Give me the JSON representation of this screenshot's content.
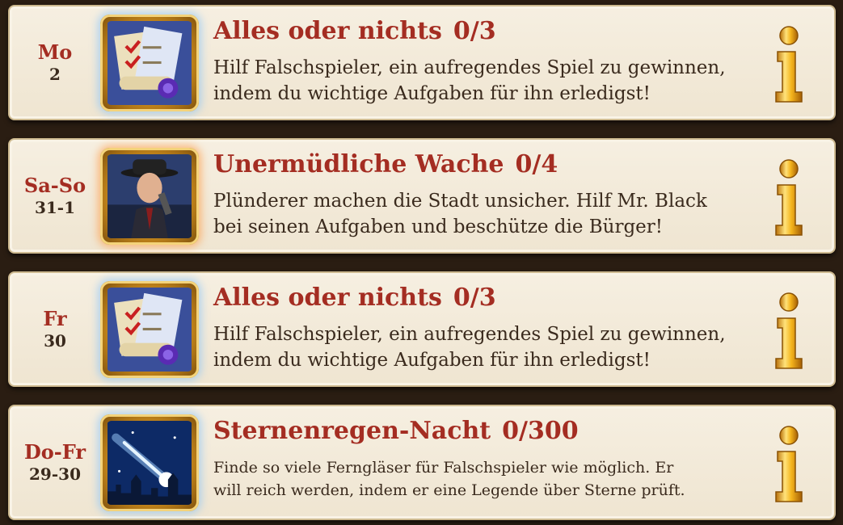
{
  "events": [
    {
      "day": "Mo",
      "date": "2",
      "title": "Alles oder nichts",
      "progress": "0/3",
      "desc_line1": "Hilf Falschspieler, ein aufregendes Spiel zu gewinnen,",
      "desc_line2": "indem du wichtige Aufgaben für ihn erledigst!",
      "icon": "quest-scroll-icon"
    },
    {
      "day": "Sa-So",
      "date": "31-1",
      "title": "Unermüdliche Wache",
      "progress": "0/4",
      "desc_line1": "Plünderer machen die Stadt unsicher. Hilf Mr. Black",
      "desc_line2": "bei seinen Aufgaben und beschütze die Bürger!",
      "icon": "detective-portrait-icon"
    },
    {
      "day": "Fr",
      "date": "30",
      "title": "Alles oder nichts",
      "progress": "0/3",
      "desc_line1": "Hilf Falschspieler, ein aufregendes Spiel zu gewinnen,",
      "desc_line2": "indem du wichtige Aufgaben für ihn erledigst!",
      "icon": "quest-scroll-icon"
    },
    {
      "day": "Do-Fr",
      "date": "29-30",
      "title": "Sternenregen-Nacht",
      "progress": "0/300",
      "desc_line1": "Finde so viele Ferngläser für Falschspieler wie möglich. Er",
      "desc_line2": "will reich werden, indem er eine Legende über Sterne prüft.",
      "icon": "shooting-star-icon"
    }
  ],
  "colors": {
    "title": "#a42d22",
    "text": "#3a2a1d",
    "card": "#f3ead8",
    "background": "#2a1d12",
    "gold": "#f1b21c"
  }
}
